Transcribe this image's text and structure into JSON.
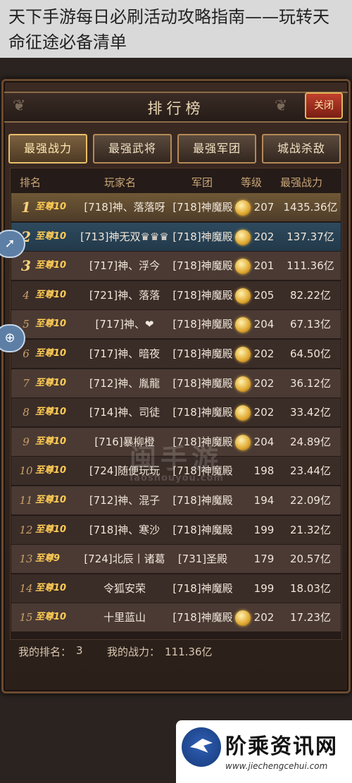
{
  "article": {
    "title": "天下手游每日必刷活动攻略指南——玩转天命征途必备清单"
  },
  "panel": {
    "title": "排行榜",
    "close_label": "关闭"
  },
  "tabs": [
    {
      "label": "最强战力",
      "active": true
    },
    {
      "label": "最强武将",
      "active": false
    },
    {
      "label": "最强军团",
      "active": false
    },
    {
      "label": "城战杀敌",
      "active": false
    }
  ],
  "columns": {
    "rank": "排名",
    "player": "玩家名",
    "legion": "军团",
    "level": "等级",
    "power": "最强战力"
  },
  "rows": [
    {
      "rank": "1",
      "vip": "至尊10",
      "name": "[718]神、落落呀",
      "legion": "[718]神魔殿",
      "medal": true,
      "level": "207",
      "power": "1435.36亿"
    },
    {
      "rank": "2",
      "vip": "至尊10",
      "name": "[713]神无双♛♛♛",
      "legion": "[718]神魔殿",
      "medal": true,
      "level": "202",
      "power": "137.37亿"
    },
    {
      "rank": "3",
      "vip": "至尊10",
      "name": "[717]神、浮今",
      "legion": "[718]神魔殿",
      "medal": true,
      "level": "201",
      "power": "111.36亿"
    },
    {
      "rank": "4",
      "vip": "至尊10",
      "name": "[721]神、落落",
      "legion": "[718]神魔殿",
      "medal": true,
      "level": "205",
      "power": "82.22亿"
    },
    {
      "rank": "5",
      "vip": "至尊10",
      "name": "[717]神、❤",
      "legion": "[718]神魔殿",
      "medal": true,
      "level": "204",
      "power": "67.13亿"
    },
    {
      "rank": "6",
      "vip": "至尊10",
      "name": "[717]神、暗夜",
      "legion": "[718]神魔殿",
      "medal": true,
      "level": "202",
      "power": "64.50亿"
    },
    {
      "rank": "7",
      "vip": "至尊10",
      "name": "[712]神、胤龍",
      "legion": "[718]神魔殿",
      "medal": true,
      "level": "202",
      "power": "36.12亿"
    },
    {
      "rank": "8",
      "vip": "至尊10",
      "name": "[714]神、司徒",
      "legion": "[718]神魔殿",
      "medal": true,
      "level": "202",
      "power": "33.42亿"
    },
    {
      "rank": "9",
      "vip": "至尊10",
      "name": "[716]暴柳橙",
      "legion": "[718]神魔殿",
      "medal": true,
      "level": "204",
      "power": "24.89亿"
    },
    {
      "rank": "10",
      "vip": "至尊10",
      "name": "[724]随便玩玩",
      "legion": "[718]神魔殿",
      "medal": false,
      "level": "198",
      "power": "23.44亿"
    },
    {
      "rank": "11",
      "vip": "至尊10",
      "name": "[712]神、混子",
      "legion": "[718]神魔殿",
      "medal": false,
      "level": "194",
      "power": "22.09亿"
    },
    {
      "rank": "12",
      "vip": "至尊10",
      "name": "[718]神、寒沙",
      "legion": "[718]神魔殿",
      "medal": false,
      "level": "199",
      "power": "21.32亿"
    },
    {
      "rank": "13",
      "vip": "至尊9",
      "name": "[724]北辰丨诸葛",
      "legion": "[731]圣殿",
      "medal": false,
      "level": "179",
      "power": "20.57亿"
    },
    {
      "rank": "14",
      "vip": "至尊10",
      "name": "令狐安荣",
      "legion": "[718]神魔殿",
      "medal": false,
      "level": "199",
      "power": "18.03亿"
    },
    {
      "rank": "15",
      "vip": "至尊10",
      "name": "十里蓝山",
      "legion": "[718]神魔殿",
      "medal": true,
      "level": "202",
      "power": "17.23亿"
    }
  ],
  "footer": {
    "my_rank_label": "我的排名：",
    "my_rank": "3",
    "my_power_label": "我的战力：",
    "my_power": "111.36亿"
  },
  "watermark": {
    "text": "闽手游",
    "sub": "Taoshouyou.com"
  },
  "brand": {
    "name": "阶乘资讯网",
    "url": "www.jiechengcehui.com"
  },
  "icons": {
    "side_top": "rocket-icon",
    "side_bottom": "gamepad-icon",
    "medal": "medal-icon"
  }
}
